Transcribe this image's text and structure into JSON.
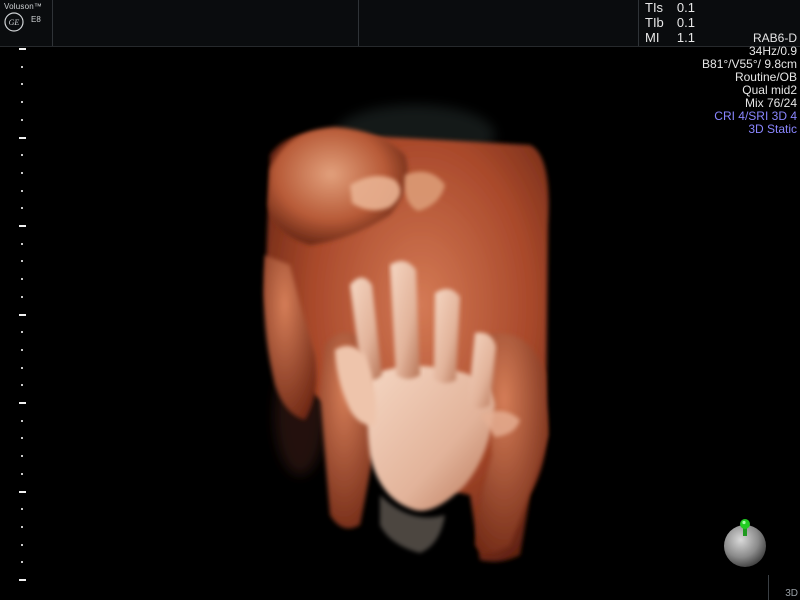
{
  "header": {
    "brand": "Voluson™",
    "model": "E8",
    "logo_icon": "ge-logo-icon",
    "safety_indices": [
      {
        "label": "TIs",
        "value": "0.1"
      },
      {
        "label": "TIb",
        "value": "0.1"
      },
      {
        "label": "MI",
        "value": "1.1"
      }
    ]
  },
  "params": {
    "probe": "RAB6-D",
    "frequency": "34Hz/0.9",
    "angles_depth": "B81°/V55°/ 9.8cm",
    "preset": "Routine/OB",
    "quality": "Qual mid2",
    "mix": "Mix 76/24",
    "filters": "CRI 4/SRI 3D 4",
    "mode": "3D Static"
  },
  "image": {
    "description_icon": "3d-fetal-render",
    "mode_tag": "3D"
  },
  "colors": {
    "param_text": "#e6e6e6",
    "param_highlight": "#8a86ff",
    "skin_dark": "#7a2e18",
    "skin_light": "#f1d2bd",
    "orientation_marker": "#22cc22"
  }
}
